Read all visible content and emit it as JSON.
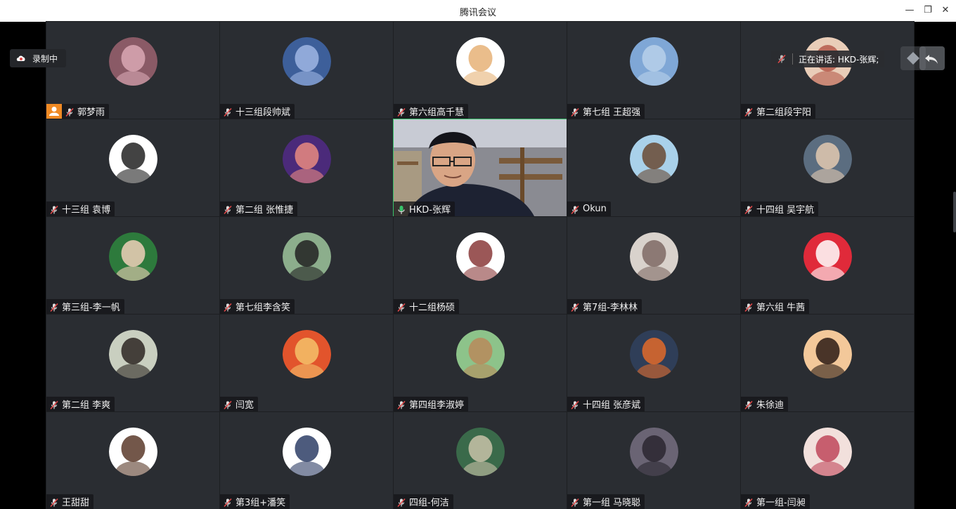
{
  "window": {
    "title": "腾讯会议",
    "controls": {
      "minimize_icon": "minimize-icon",
      "restore_icon": "restore-icon",
      "close_icon": "close-icon"
    }
  },
  "recording": {
    "label": "录制中",
    "icon": "cloud-record-icon"
  },
  "speaking": {
    "label": "正在讲话: HKD-张辉;",
    "icon": "mic-off-icon"
  },
  "colors": {
    "accent_green": "#37c36a",
    "muted_red": "#e04848",
    "host_orange": "#f08a24",
    "tile_bg": "#2a2d32"
  },
  "participants": [
    {
      "name": "郭梦雨",
      "mic": "muted",
      "host": true,
      "avatar": "#8a5a66",
      "avatar2": "#d9a8b4"
    },
    {
      "name": "十三组段帅斌",
      "mic": "muted",
      "avatar": "#3d5f9a",
      "avatar2": "#9fb6e4"
    },
    {
      "name": "第六组高千慧",
      "mic": "muted",
      "avatar": "#ffffff",
      "avatar2": "#e6b277"
    },
    {
      "name": "第七组 王超强",
      "mic": "muted",
      "avatar": "#7fa7d6",
      "avatar2": "#b7d0ea"
    },
    {
      "name": "第二组段宇阳",
      "mic": "muted",
      "avatar": "#e9cdb8",
      "avatar2": "#b65b4b"
    },
    {
      "name": "十三组 袁博",
      "mic": "muted",
      "avatar": "#ffffff",
      "avatar2": "#222222"
    },
    {
      "name": "第二组 张惟捷",
      "mic": "muted",
      "avatar": "#4b2a7a",
      "avatar2": "#e98a80"
    },
    {
      "name": "HKD-张辉",
      "mic": "active",
      "video": true
    },
    {
      "name": "Okun",
      "mic": "muted",
      "avatar": "#a9d1ea",
      "avatar2": "#6a4a34"
    },
    {
      "name": "十四组 吴宇航",
      "mic": "muted",
      "avatar": "#5b6d80",
      "avatar2": "#e3c9b0"
    },
    {
      "name": "第三组-李一帆",
      "mic": "muted",
      "avatar": "#2d7a3c",
      "avatar2": "#f0d0b8"
    },
    {
      "name": "第七组李含笑",
      "mic": "muted",
      "avatar": "#8cae8c",
      "avatar2": "#222222"
    },
    {
      "name": "十二组杨硕",
      "mic": "muted",
      "avatar": "#ffffff",
      "avatar2": "#8a3a3a"
    },
    {
      "name": "第7组-李林林",
      "mic": "muted",
      "avatar": "#d9d2cc",
      "avatar2": "#7e6a64"
    },
    {
      "name": "第六组 牛茜",
      "mic": "muted",
      "avatar": "#e02a3a",
      "avatar2": "#ffffff"
    },
    {
      "name": "第二组 李爽",
      "mic": "muted",
      "avatar": "#c9cfc0",
      "avatar2": "#2d2622"
    },
    {
      "name": "闫宽",
      "mic": "muted",
      "avatar": "#e2542c",
      "avatar2": "#f4c26a"
    },
    {
      "name": "第四组李淑婷",
      "mic": "muted",
      "avatar": "#8dc38a",
      "avatar2": "#b98a5a"
    },
    {
      "name": "十四组 张彦斌",
      "mic": "muted",
      "avatar": "#2f3e58",
      "avatar2": "#e06a2a"
    },
    {
      "name": "朱徐迪",
      "mic": "muted",
      "avatar": "#f3c89a",
      "avatar2": "#2a1a14"
    },
    {
      "name": "王甜甜",
      "mic": "muted",
      "avatar": "#ffffff",
      "avatar2": "#5a3a2a"
    },
    {
      "name": "第3组+潘笑",
      "mic": "muted",
      "avatar": "#ffffff",
      "avatar2": "#2e3e66"
    },
    {
      "name": "四组-何洁",
      "mic": "muted",
      "avatar": "#3a6a4a",
      "avatar2": "#c9c2a8"
    },
    {
      "name": "第一组 马晓聪",
      "mic": "muted",
      "avatar": "#6a6474",
      "avatar2": "#2a2630"
    },
    {
      "name": "第一组-闫昶",
      "mic": "muted",
      "avatar": "#f2e0dc",
      "avatar2": "#c0465a"
    }
  ]
}
